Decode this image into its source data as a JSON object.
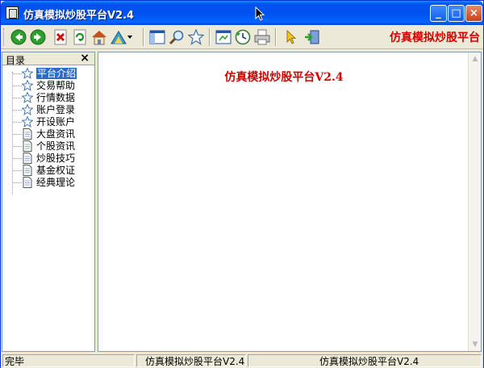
{
  "window": {
    "title": "仿真模拟炒股平台V2.4",
    "controls": {
      "minimize": "_",
      "maximize": "□",
      "close": "×"
    }
  },
  "toolbar": {
    "buttons": [
      {
        "name": "back",
        "icon": "back-arrow-icon"
      },
      {
        "name": "forward",
        "icon": "forward-arrow-icon"
      },
      {
        "name": "stop",
        "icon": "stop-icon"
      },
      {
        "name": "refresh",
        "icon": "refresh-icon"
      },
      {
        "name": "home",
        "icon": "home-icon"
      },
      {
        "name": "locate",
        "icon": "locate-icon"
      },
      {
        "name": "show-pane",
        "icon": "pane-icon"
      },
      {
        "name": "search",
        "icon": "search-icon"
      },
      {
        "name": "favorites",
        "icon": "star-icon"
      },
      {
        "name": "window",
        "icon": "window-icon"
      },
      {
        "name": "history",
        "icon": "history-icon"
      },
      {
        "name": "print",
        "icon": "print-icon"
      },
      {
        "name": "pointer",
        "icon": "pointer-icon"
      },
      {
        "name": "exit",
        "icon": "exit-icon"
      }
    ],
    "brand": "仿真模拟炒股平台"
  },
  "sidebar": {
    "title": "目录",
    "close_label": "×",
    "items": [
      {
        "label": "平台介绍",
        "icon": "star-icon",
        "selected": true
      },
      {
        "label": "交易帮助",
        "icon": "star-icon"
      },
      {
        "label": "行情数据",
        "icon": "star-icon"
      },
      {
        "label": "账户登录",
        "icon": "star-icon"
      },
      {
        "label": "开设账户",
        "icon": "star-icon"
      },
      {
        "label": "大盘资讯",
        "icon": "page-icon"
      },
      {
        "label": "个股资讯",
        "icon": "page-icon"
      },
      {
        "label": "炒股技巧",
        "icon": "page-icon"
      },
      {
        "label": "基金权证",
        "icon": "page-icon"
      },
      {
        "label": "经典理论",
        "icon": "page-icon"
      }
    ]
  },
  "content": {
    "title": "仿真模拟炒股平台V2.4"
  },
  "statusbar": {
    "status": "完毕",
    "pane2": "仿真模拟炒股平台V2.4",
    "pane3": "仿真模拟炒股平台V2.4"
  },
  "colors": {
    "titlebar": "#0053ee",
    "brand_red": "#d40000",
    "selection": "#316ac5"
  }
}
